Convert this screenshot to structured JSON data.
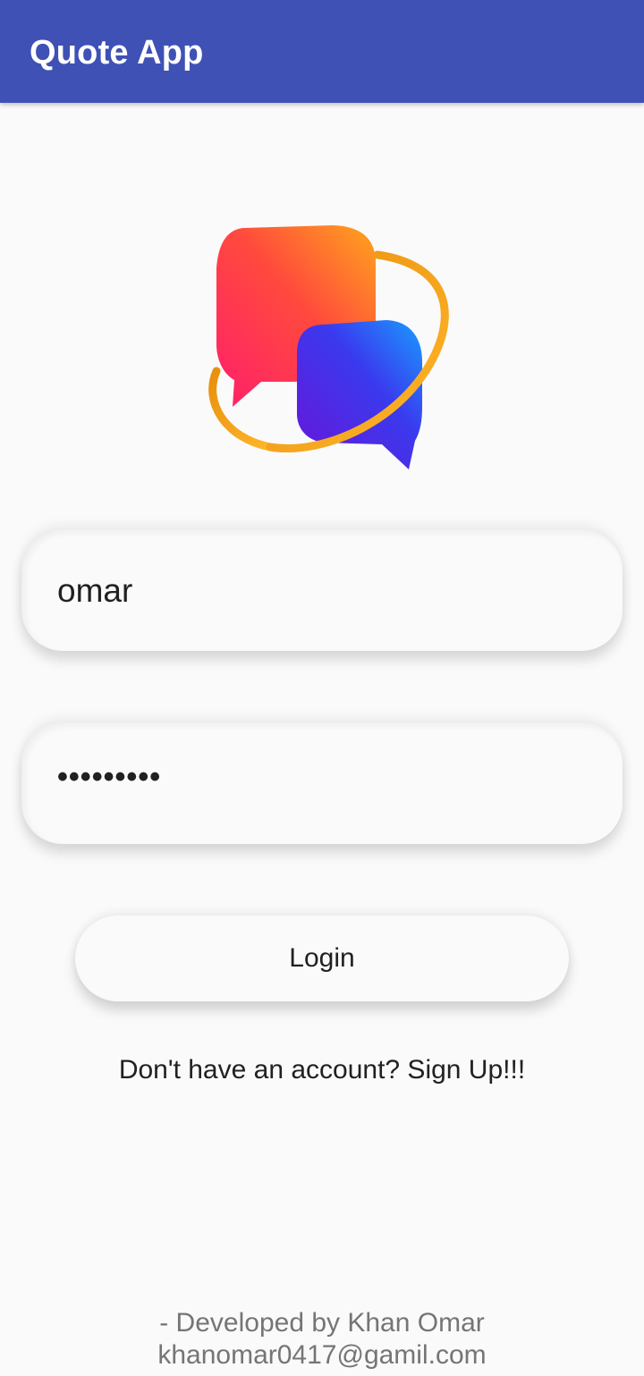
{
  "app_bar": {
    "title": "Quote App",
    "color": "#3f51b5"
  },
  "logo": {
    "icon": "chat-bubbles-logo-icon"
  },
  "login_form": {
    "username_value": "omar",
    "password_value": "•••••••••",
    "login_label": "Login",
    "signup_text": "Don't have an account? Sign Up!!!"
  },
  "footer": {
    "developer": "- Developed by Khan Omar",
    "email": "khanomar0417@gamil.com"
  }
}
